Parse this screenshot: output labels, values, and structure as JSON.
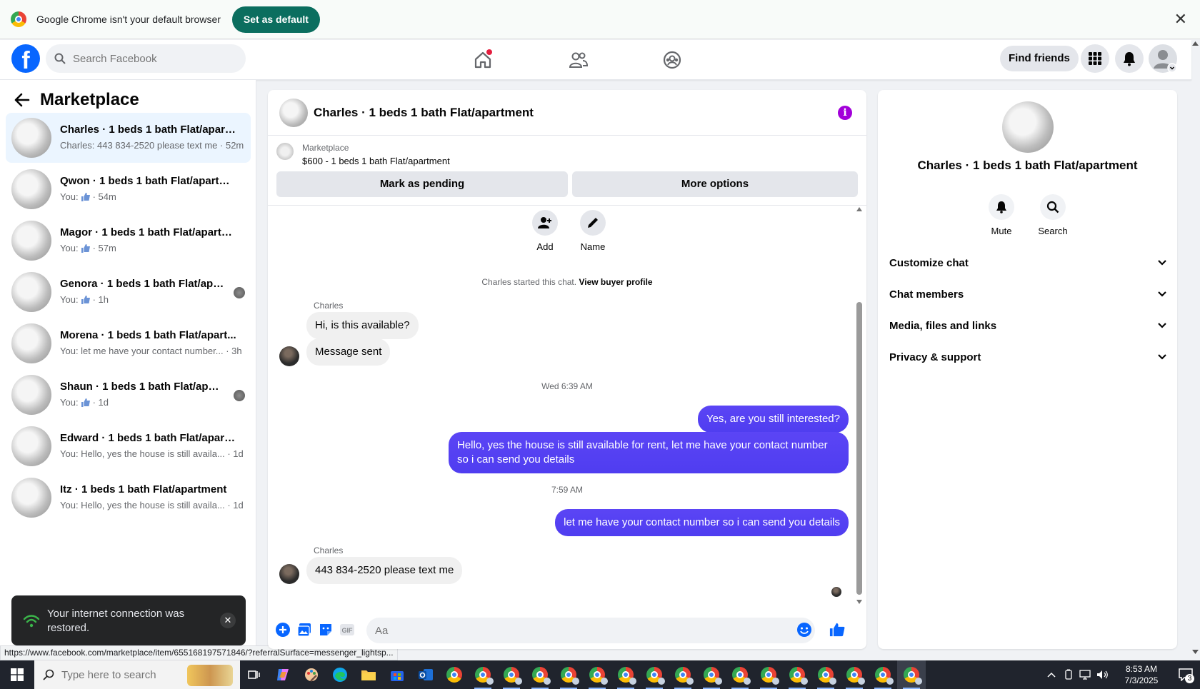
{
  "chrome_bar": {
    "message": "Google Chrome isn't your default browser",
    "set_default_label": "Set as default",
    "close_glyph": "✕"
  },
  "fb_header": {
    "logo_glyph": "f",
    "search_placeholder": "Search Facebook",
    "find_friends_label": "Find friends",
    "icons": [
      "home-icon",
      "friends-icon",
      "groups-icon",
      "menu-grid-icon",
      "notifications-icon",
      "account-icon"
    ]
  },
  "sidebar": {
    "title": "Marketplace",
    "conversations": [
      {
        "title": "Charles · 1 beds 1 bath Flat/apartm...",
        "subtitle": "Charles: 443 834-2520 please text me · 52m",
        "active": true
      },
      {
        "title": "Qwon · 1 beds 1 bath Flat/apartment",
        "prefix": "You:",
        "suffix": "· 54m"
      },
      {
        "title": "Magor · 1 beds 1 bath Flat/apartm...",
        "prefix": "You:",
        "suffix": "· 57m"
      },
      {
        "title": "Genora · 1 beds 1 bath Flat/apar...",
        "prefix": "You:",
        "suffix": "· 1h"
      },
      {
        "title": "Morena · 1 beds 1 bath Flat/apart...",
        "subtitle": "You: let me have your contact number... · 3h"
      },
      {
        "title": "Shaun · 1 beds 1 bath Flat/apart...",
        "prefix": "You:",
        "suffix": "· 1d"
      },
      {
        "title": "Edward · 1 beds 1 bath Flat/apartm...",
        "subtitle": "You: Hello, yes the house is still availa... · 1d"
      },
      {
        "title": "Itz · 1 beds 1 bath Flat/apartment",
        "subtitle": "You: Hello, yes the house is still availa... · 1d"
      }
    ],
    "toast_text": "Your internet connection was restored.",
    "toast_close": "✕"
  },
  "status_url": "https://www.facebook.com/marketplace/item/655168197571846/?referralSurface=messenger_lightsp...",
  "chat": {
    "title": "Charles · 1 beds 1 bath Flat/apartment",
    "info_glyph": "i",
    "listing_source": "Marketplace",
    "listing_price": "$600 - 1 beds 1 bath Flat/apartment",
    "mark_pending_label": "Mark as pending",
    "more_options_label": "More options",
    "add_label": "Add",
    "name_label": "Name",
    "started_text": "Charles started this chat.",
    "view_profile_label": "View buyer profile",
    "messages": {
      "sender_name_1": "Charles",
      "in_1": "Hi, is this available?",
      "in_2": "Message sent",
      "timestamp_1": "Wed 6:39 AM",
      "out_1": "Yes, are you still interested?",
      "out_2": "Hello, yes the house is still available for rent, let me have your contact number so i can send you details",
      "timestamp_2": "7:59 AM",
      "out_3": "let me have your contact number so i can send you details",
      "sender_name_2": "Charles",
      "in_3": "443 834-2520 please text me"
    },
    "composer_placeholder": "Aa",
    "composer_gif_label": "GIF"
  },
  "details_panel": {
    "title": "Charles · 1 beds 1 bath Flat/apartment",
    "mute_label": "Mute",
    "search_label": "Search",
    "rows": [
      "Customize chat",
      "Chat members",
      "Media, files and links",
      "Privacy & support"
    ]
  },
  "taskbar": {
    "search_placeholder": "Type here to search",
    "clock_time": "8:53 AM",
    "clock_date": "7/3/2025",
    "notification_count": "3"
  },
  "colors": {
    "fb_blue": "#0866ff",
    "outgoing_bubble": "#4f3df0",
    "set_default_green": "#0b6e5f",
    "info_purple": "#a200d9"
  }
}
